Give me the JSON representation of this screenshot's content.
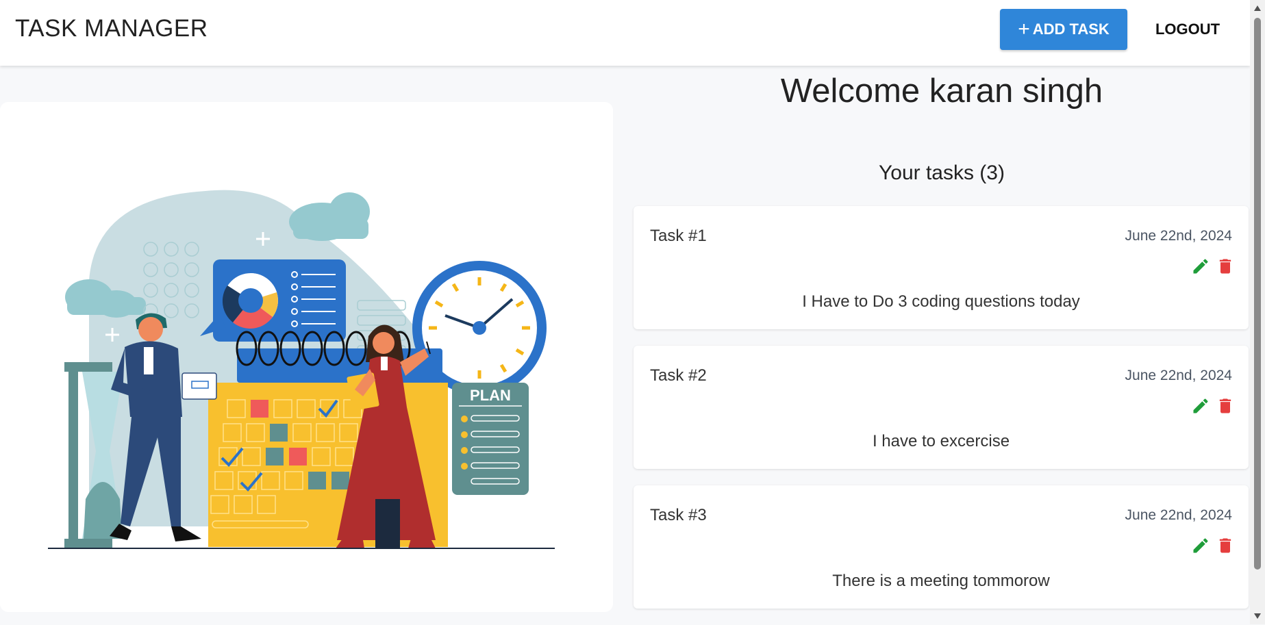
{
  "header": {
    "brand": "TASK MANAGER",
    "add_task_label": "ADD TASK",
    "logout_label": "LOGOUT"
  },
  "main": {
    "welcome": "Welcome karan singh",
    "tasks_heading": "Your tasks (3)",
    "tasks": [
      {
        "title": "Task #1",
        "date": "June 22nd, 2024",
        "description": "I Have to Do 3  coding  questions today"
      },
      {
        "title": "Task #2",
        "date": "June 22nd, 2024",
        "description": "I have to excercise"
      },
      {
        "title": "Task #3",
        "date": "June 22nd, 2024",
        "description": "There is a meeting tommorow"
      }
    ]
  },
  "illustration": {
    "plan_label": "PLAN"
  },
  "icons": {
    "add": "plus-icon",
    "edit": "pencil-icon",
    "delete": "trash-icon"
  },
  "colors": {
    "primary": "#2f86d9",
    "edit": "#1f9d3a",
    "delete": "#e53e3e"
  }
}
